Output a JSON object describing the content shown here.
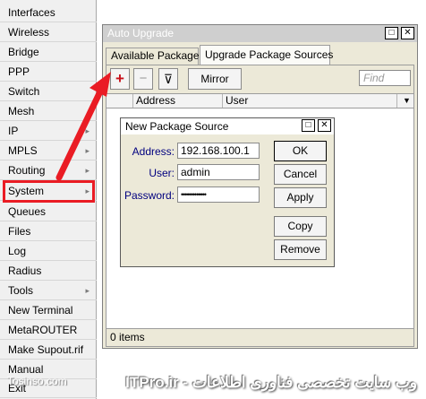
{
  "sidebar": {
    "items": [
      {
        "label": "Interfaces",
        "arrow": false
      },
      {
        "label": "Wireless",
        "arrow": false
      },
      {
        "label": "Bridge",
        "arrow": false
      },
      {
        "label": "PPP",
        "arrow": false
      },
      {
        "label": "Switch",
        "arrow": false
      },
      {
        "label": "Mesh",
        "arrow": false
      },
      {
        "label": "IP",
        "arrow": true
      },
      {
        "label": "MPLS",
        "arrow": true
      },
      {
        "label": "Routing",
        "arrow": true
      },
      {
        "label": "System",
        "arrow": true
      },
      {
        "label": "Queues",
        "arrow": false
      },
      {
        "label": "Files",
        "arrow": false
      },
      {
        "label": "Log",
        "arrow": false
      },
      {
        "label": "Radius",
        "arrow": false
      },
      {
        "label": "Tools",
        "arrow": true
      },
      {
        "label": "New Terminal",
        "arrow": false
      },
      {
        "label": "MetaROUTER",
        "arrow": false
      },
      {
        "label": "Make Supout.rif",
        "arrow": false
      },
      {
        "label": "Manual",
        "arrow": false
      },
      {
        "label": "Exit",
        "arrow": false
      }
    ],
    "submenu_glyph": "▸"
  },
  "window": {
    "title": "Auto Upgrade",
    "tabs": [
      "Available Packages",
      "Upgrade Package Sources"
    ],
    "active_tab": 1,
    "toolbar": {
      "add_glyph": "+",
      "remove_glyph": "−",
      "filter_glyph": "⊽",
      "mirror_label": "Mirror",
      "find_placeholder": "Find"
    },
    "columns": [
      "Address",
      "User"
    ],
    "status": "0 items",
    "restore_glyph": "□",
    "close_glyph": "✕"
  },
  "dialog": {
    "title": "New Package Source",
    "fields": {
      "address_label": "Address:",
      "address_value": "192.168.100.1",
      "user_label": "User:",
      "user_value": "admin",
      "password_label": "Password:",
      "password_value": "•••••••••••••"
    },
    "buttons": {
      "ok": "OK",
      "cancel": "Cancel",
      "apply": "Apply",
      "copy": "Copy",
      "remove": "Remove"
    }
  },
  "footer": {
    "left_text": "Tosinso.com",
    "watermark": "ITPro.ir - وب سایت تخصصی فناوری اطلاعات"
  },
  "colors": {
    "highlight": "#ea1c24",
    "add_icon": "#c8101a"
  }
}
